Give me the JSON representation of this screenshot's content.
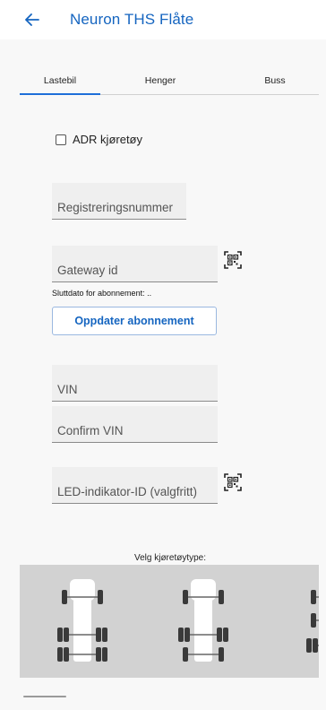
{
  "appbar": {
    "title": "Neuron THS Flåte",
    "back_icon": "arrow-left-icon"
  },
  "tabs": [
    {
      "label": "Lastebil",
      "selected": true
    },
    {
      "label": "Henger",
      "selected": false
    },
    {
      "label": "Buss",
      "selected": false
    }
  ],
  "form": {
    "adr_label": "ADR kjøretøy",
    "adr_checked": false,
    "registration_placeholder": "Registreringsnummer",
    "gateway_placeholder": "Gateway id",
    "subscription_end_text": "Sluttdato for abonnement: ..",
    "update_button_label": "Oppdater abonnement",
    "vin_placeholder": "VIN",
    "confirm_vin_placeholder": "Confirm VIN",
    "led_placeholder": "LED-indikator-ID (valgfritt)",
    "vehicle_type_label": "Velg kjøretøytype:",
    "qr_icon": "qr-code-icon"
  },
  "colors": {
    "accent": "#1565c0",
    "tab_indicator": "#1e6fd9",
    "vehicle_strip_bg": "#d2d2d2"
  }
}
